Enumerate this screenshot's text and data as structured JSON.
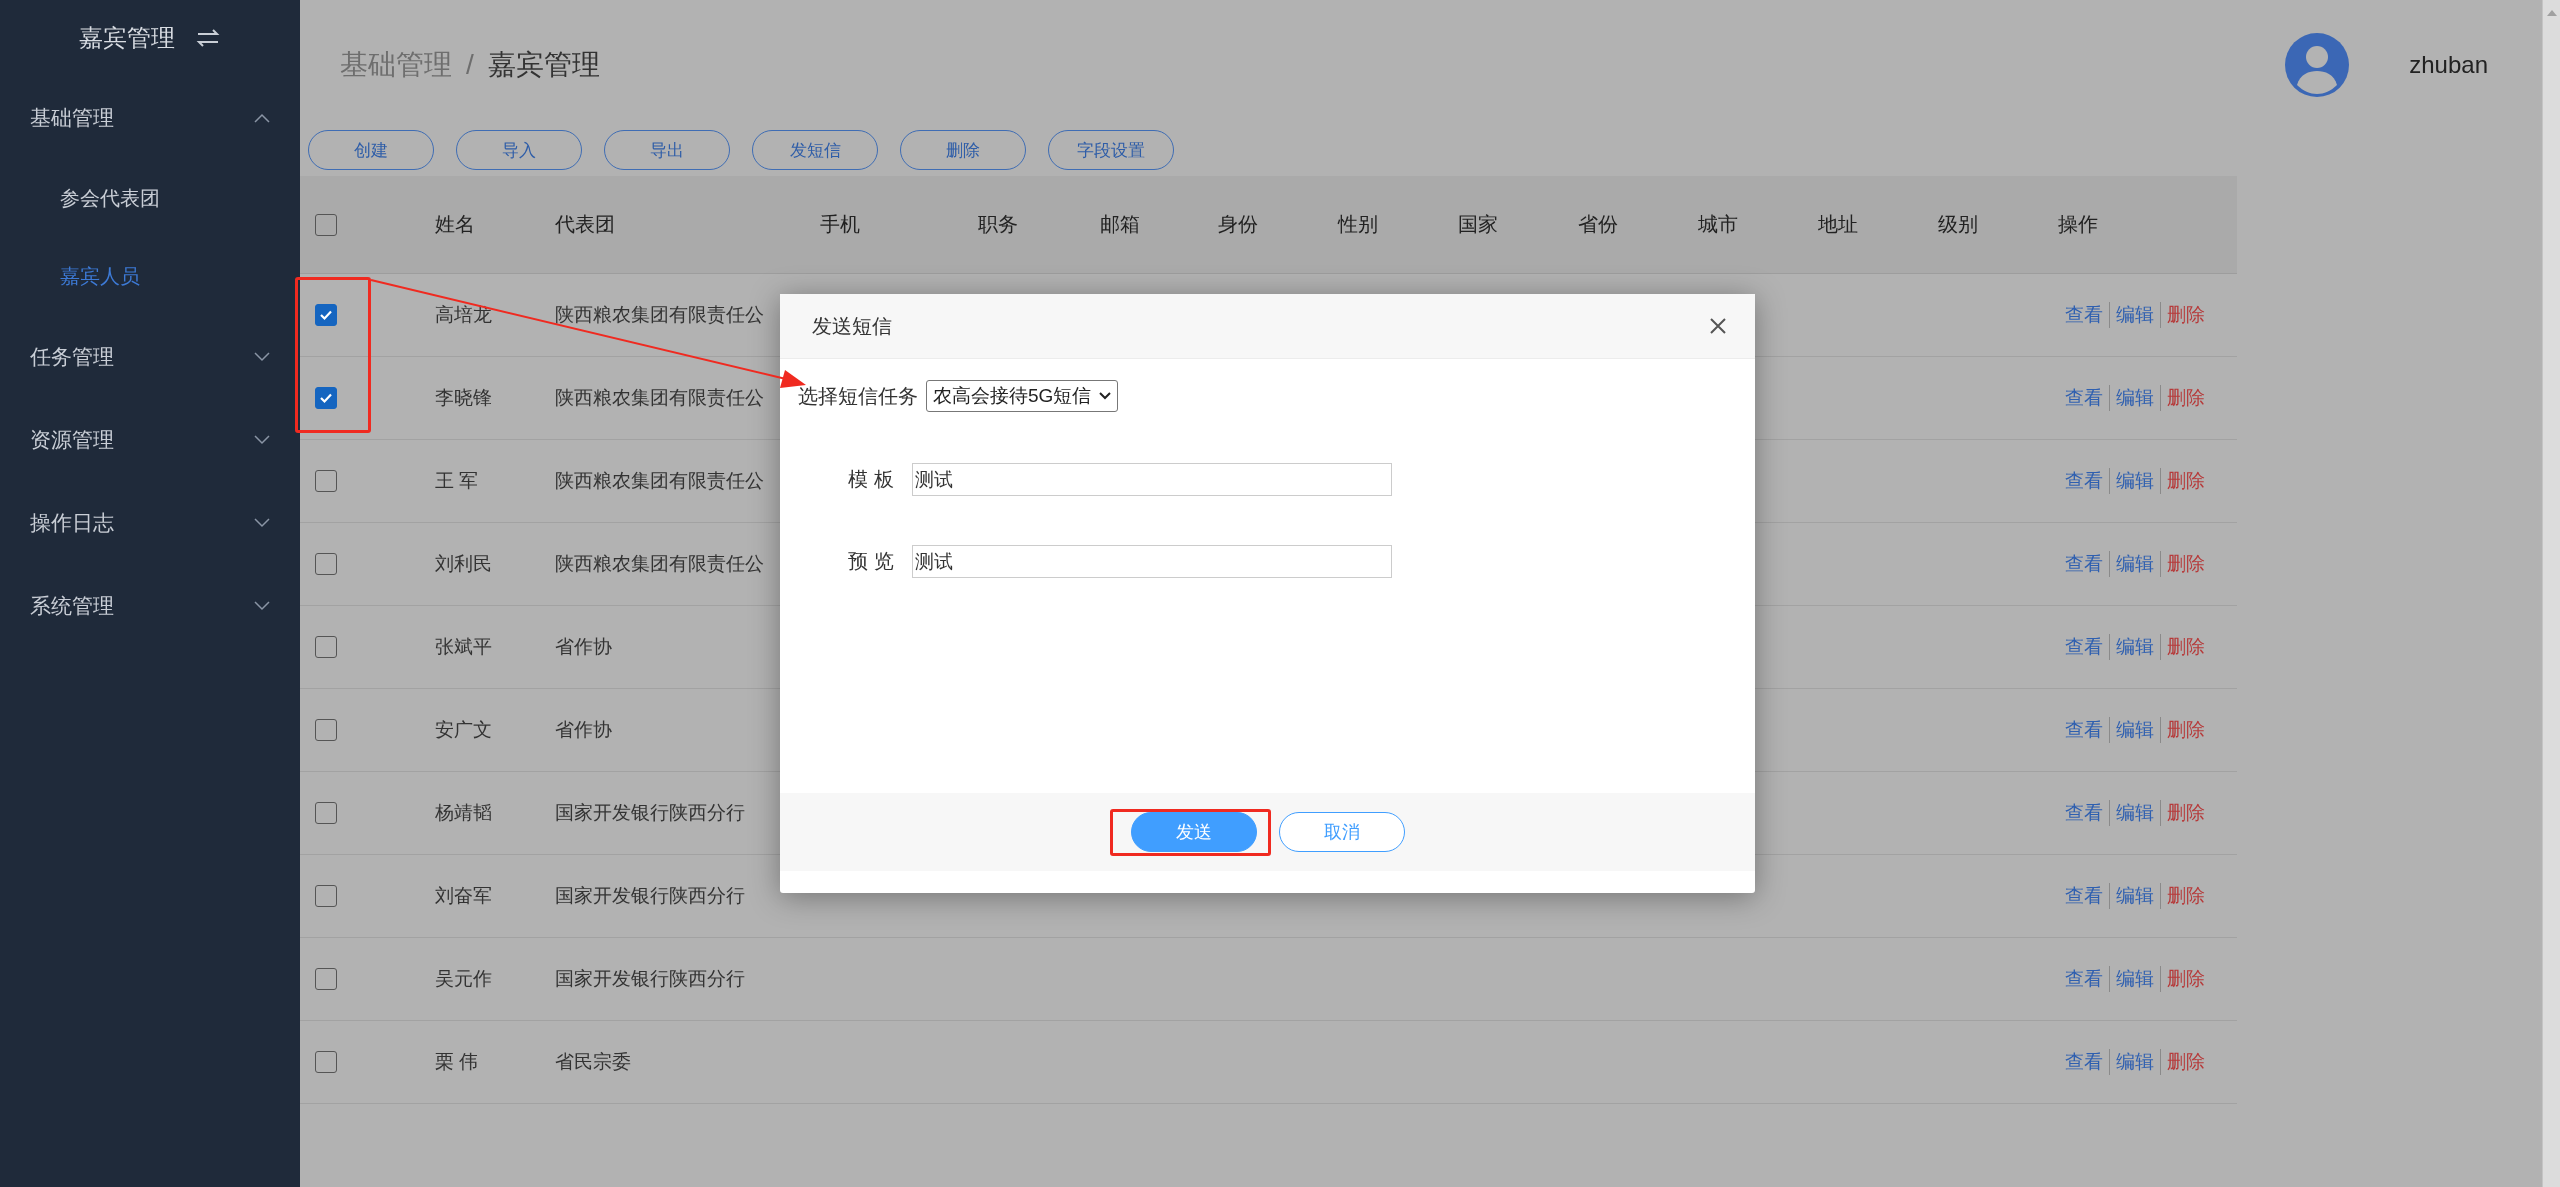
{
  "sidebar": {
    "title": "嘉宾管理",
    "items": [
      {
        "label": "基础管理",
        "expanded": true,
        "children": [
          {
            "label": "参会代表团",
            "selected": false
          },
          {
            "label": "嘉宾人员",
            "selected": true
          }
        ]
      },
      {
        "label": "任务管理",
        "expanded": false
      },
      {
        "label": "资源管理",
        "expanded": false
      },
      {
        "label": "操作日志",
        "expanded": false
      },
      {
        "label": "系统管理",
        "expanded": false
      }
    ]
  },
  "breadcrumb": {
    "separator": "/",
    "items": [
      "基础管理",
      "嘉宾管理"
    ]
  },
  "user": {
    "name": "zhuban"
  },
  "toolbar": [
    "创建",
    "导入",
    "导出",
    "发短信",
    "删除",
    "字段设置"
  ],
  "table": {
    "header_checked": false,
    "columns": [
      "姓名",
      "代表团",
      "手机",
      "职务",
      "邮箱",
      "身份",
      "性别",
      "国家",
      "省份",
      "城市",
      "地址",
      "级别",
      "操作"
    ],
    "rows": [
      {
        "checked": true,
        "name": "高培龙",
        "group": "陕西粮农集团有限责任公",
        "actions": [
          {
            "label": "查看",
            "kind": "view"
          },
          {
            "label": "编辑",
            "kind": "edit"
          },
          {
            "label": "删除",
            "kind": "delete"
          }
        ]
      },
      {
        "checked": true,
        "name": "李晓锋",
        "group": "陕西粮农集团有限责任公",
        "actions": [
          {
            "label": "查看",
            "kind": "view"
          },
          {
            "label": "编辑",
            "kind": "edit"
          },
          {
            "label": "删除",
            "kind": "delete"
          }
        ]
      },
      {
        "checked": false,
        "name": "王 军",
        "group": "陕西粮农集团有限责任公",
        "actions": [
          {
            "label": "查看",
            "kind": "view"
          },
          {
            "label": "编辑",
            "kind": "edit"
          },
          {
            "label": "删除",
            "kind": "delete"
          }
        ]
      },
      {
        "checked": false,
        "name": "刘利民",
        "group": "陕西粮农集团有限责任公",
        "actions": [
          {
            "label": "查看",
            "kind": "view"
          },
          {
            "label": "编辑",
            "kind": "edit"
          },
          {
            "label": "删除",
            "kind": "delete"
          }
        ]
      },
      {
        "checked": false,
        "name": "张斌平",
        "group": "省作协",
        "actions": [
          {
            "label": "查看",
            "kind": "view"
          },
          {
            "label": "编辑",
            "kind": "edit"
          },
          {
            "label": "删除",
            "kind": "delete"
          }
        ]
      },
      {
        "checked": false,
        "name": "安广文",
        "group": "省作协",
        "actions": [
          {
            "label": "查看",
            "kind": "view"
          },
          {
            "label": "编辑",
            "kind": "edit"
          },
          {
            "label": "删除",
            "kind": "delete"
          }
        ]
      },
      {
        "checked": false,
        "name": "杨靖韬",
        "group": "国家开发银行陕西分行",
        "actions": [
          {
            "label": "查看",
            "kind": "view"
          },
          {
            "label": "编辑",
            "kind": "edit"
          },
          {
            "label": "删除",
            "kind": "delete"
          }
        ]
      },
      {
        "checked": false,
        "name": "刘奋军",
        "group": "国家开发银行陕西分行",
        "actions": [
          {
            "label": "查看",
            "kind": "view"
          },
          {
            "label": "编辑",
            "kind": "edit"
          },
          {
            "label": "删除",
            "kind": "delete"
          }
        ]
      },
      {
        "checked": false,
        "name": "吴元作",
        "group": "国家开发银行陕西分行",
        "actions": [
          {
            "label": "查看",
            "kind": "view"
          },
          {
            "label": "编辑",
            "kind": "edit"
          },
          {
            "label": "删除",
            "kind": "delete"
          }
        ]
      },
      {
        "checked": false,
        "name": "栗 伟",
        "group": "省民宗委",
        "actions": [
          {
            "label": "查看",
            "kind": "view"
          },
          {
            "label": "编辑",
            "kind": "edit"
          },
          {
            "label": "删除",
            "kind": "delete"
          }
        ]
      }
    ]
  },
  "dialog": {
    "title": "发送短信",
    "task_label": "选择短信任务",
    "task_value": "农高会接待5G短信",
    "fields": [
      {
        "label": "模 板",
        "value": "测试"
      },
      {
        "label": "预 览",
        "value": "测试"
      }
    ],
    "buttons": [
      {
        "label": "发送",
        "kind": "primary"
      },
      {
        "label": "取消",
        "kind": "default"
      }
    ]
  }
}
